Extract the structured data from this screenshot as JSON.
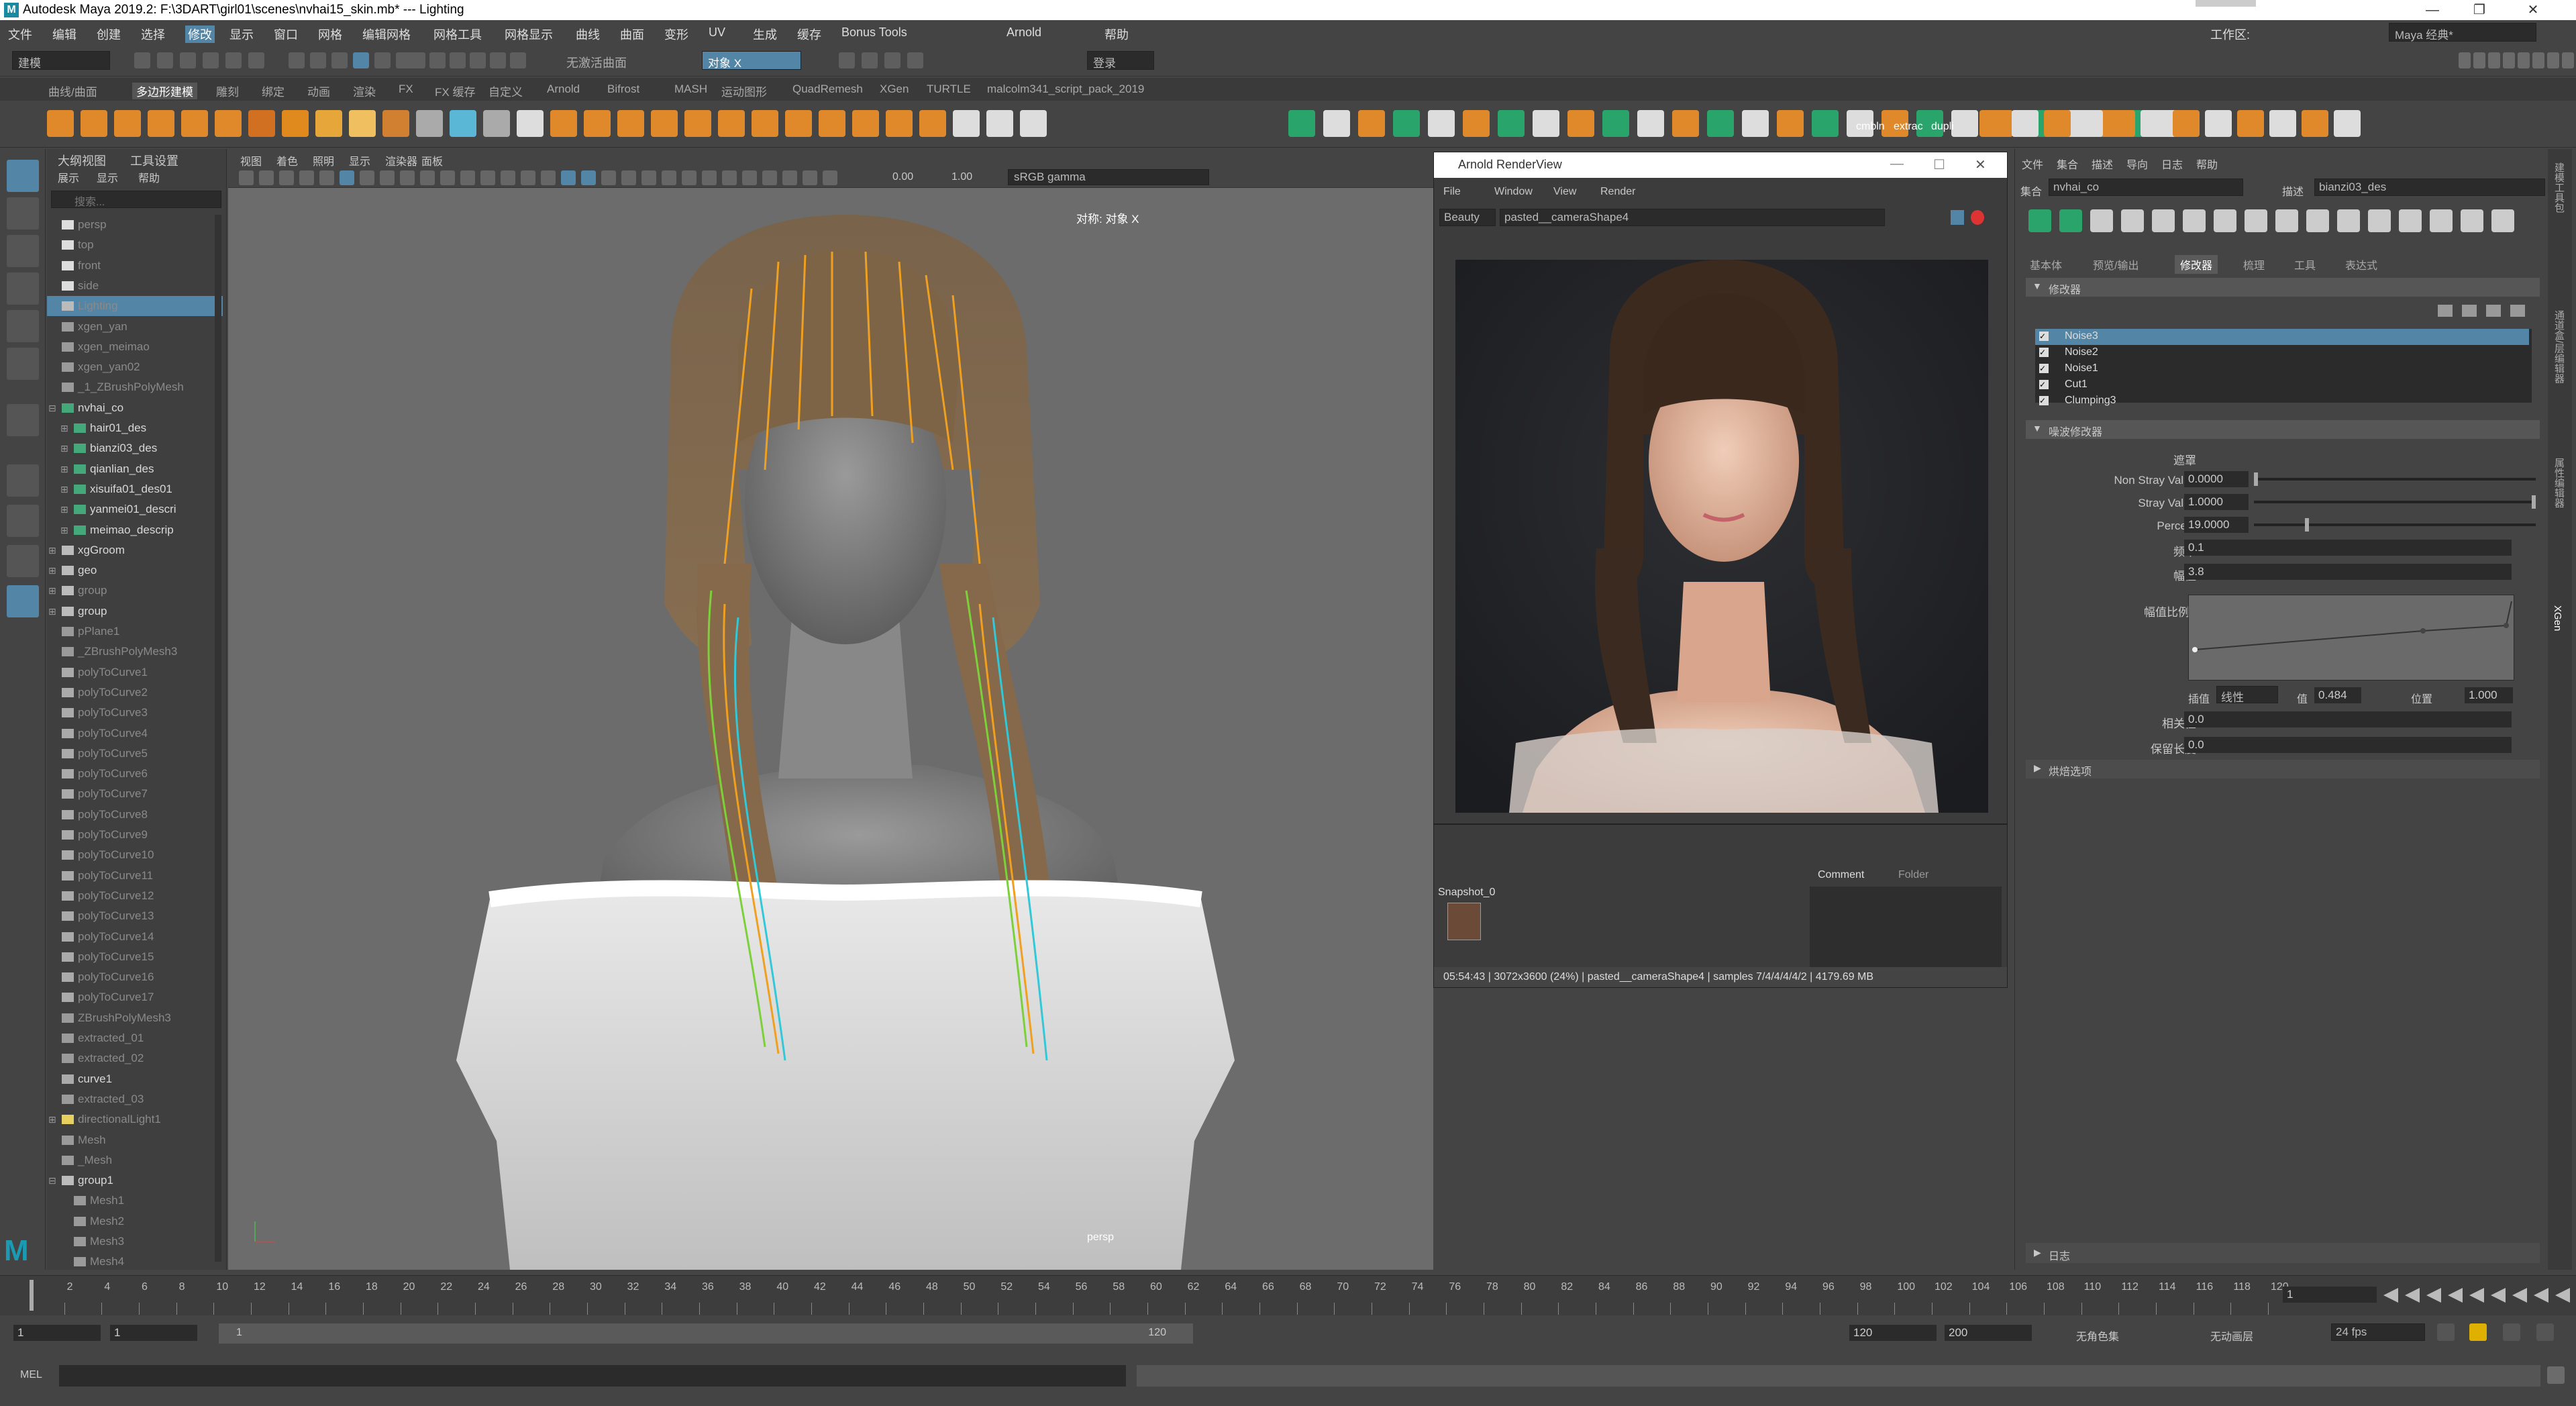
{
  "window": {
    "title": "Autodesk Maya 2019.2: F:\\3DART\\girl01\\scenes\\nvhai15_skin.mb*  ---  Lighting",
    "logo": "M"
  },
  "menubar": {
    "items": [
      "文件",
      "编辑",
      "创建",
      "选择",
      "修改",
      "显示",
      "窗口",
      "网格",
      "编辑网格",
      "网格工具",
      "网格显示",
      "曲线",
      "曲面",
      "变形",
      "UV",
      "生成",
      "缓存",
      "Bonus Tools",
      "Arnold",
      "帮助"
    ],
    "workspace_label": "工作区:",
    "workspace_value": "Maya 经典*"
  },
  "statusline": {
    "mode": "建模",
    "no_live_surface": "无激活曲面",
    "symmetry": "对象 X",
    "user": "登录"
  },
  "shelf": {
    "tabs": [
      "曲线/曲面",
      "多边形建模",
      "雕刻",
      "绑定",
      "动画",
      "渲染",
      "FX",
      "FX 缓存",
      "自定义",
      "Arnold",
      "Bifrost",
      "MASH",
      "运动图形",
      "QuadRemesh",
      "XGen",
      "TURTLE",
      "malcolm341_script_pack_2019"
    ],
    "active_tab": "多边形建模",
    "text_buttons": [
      "cmbln",
      "extrac",
      "dupli"
    ]
  },
  "outliner": {
    "menus": [
      "大纲视图",
      "工具设置"
    ],
    "submenus": [
      "展示",
      "显示",
      "帮助"
    ],
    "search_placeholder": "搜索...",
    "rows": [
      {
        "label": "persp",
        "icon": "camera",
        "indent": 0,
        "dim": true
      },
      {
        "label": "top",
        "icon": "camera",
        "indent": 0,
        "dim": true
      },
      {
        "label": "front",
        "icon": "camera",
        "indent": 0,
        "dim": true
      },
      {
        "label": "side",
        "icon": "camera",
        "indent": 0,
        "dim": true
      },
      {
        "label": "Lighting",
        "icon": "group",
        "indent": 0,
        "dim": true,
        "selected": true
      },
      {
        "label": "xgen_yan",
        "icon": "mesh",
        "indent": 0,
        "dim": true
      },
      {
        "label": "xgen_meimao",
        "icon": "mesh",
        "indent": 0,
        "dim": true
      },
      {
        "label": "xgen_yan02",
        "icon": "mesh",
        "indent": 0,
        "dim": true
      },
      {
        "label": "_1_ZBrushPolyMesh",
        "icon": "mesh",
        "indent": 0,
        "dim": true
      },
      {
        "label": "nvhai_co",
        "icon": "xgen",
        "indent": 0,
        "expand": "minus"
      },
      {
        "label": "hair01_des",
        "icon": "xgen",
        "indent": 1,
        "expand": "plus"
      },
      {
        "label": "bianzi03_des",
        "icon": "xgen",
        "indent": 1,
        "expand": "plus"
      },
      {
        "label": "qianlian_des",
        "icon": "xgen",
        "indent": 1,
        "expand": "plus"
      },
      {
        "label": "xisuifa01_des01",
        "icon": "xgen",
        "indent": 1,
        "expand": "plus"
      },
      {
        "label": "yanmei01_descri",
        "icon": "xgen",
        "indent": 1,
        "expand": "plus"
      },
      {
        "label": "meimao_descrip",
        "icon": "xgen",
        "indent": 1,
        "expand": "plus"
      },
      {
        "label": "xgGroom",
        "icon": "group",
        "indent": 0,
        "expand": "plus"
      },
      {
        "label": "geo",
        "icon": "group",
        "indent": 0,
        "expand": "plus"
      },
      {
        "label": "group",
        "icon": "group",
        "indent": 0,
        "expand": "plus",
        "dim": true
      },
      {
        "label": "group",
        "icon": "group",
        "indent": 0,
        "expand": "plus"
      },
      {
        "label": "pPlane1",
        "icon": "mesh",
        "indent": 0,
        "dim": true
      },
      {
        "label": "_ZBrushPolyMesh3",
        "icon": "mesh",
        "indent": 0,
        "dim": true
      },
      {
        "label": "polyToCurve1",
        "icon": "curve",
        "indent": 0,
        "dim": true
      },
      {
        "label": "polyToCurve2",
        "icon": "curve",
        "indent": 0,
        "dim": true
      },
      {
        "label": "polyToCurve3",
        "icon": "curve",
        "indent": 0,
        "dim": true
      },
      {
        "label": "polyToCurve4",
        "icon": "curve",
        "indent": 0,
        "dim": true
      },
      {
        "label": "polyToCurve5",
        "icon": "curve",
        "indent": 0,
        "dim": true
      },
      {
        "label": "polyToCurve6",
        "icon": "curve",
        "indent": 0,
        "dim": true
      },
      {
        "label": "polyToCurve7",
        "icon": "curve",
        "indent": 0,
        "dim": true
      },
      {
        "label": "polyToCurve8",
        "icon": "curve",
        "indent": 0,
        "dim": true
      },
      {
        "label": "polyToCurve9",
        "icon": "curve",
        "indent": 0,
        "dim": true
      },
      {
        "label": "polyToCurve10",
        "icon": "curve",
        "indent": 0,
        "dim": true
      },
      {
        "label": "polyToCurve11",
        "icon": "curve",
        "indent": 0,
        "dim": true
      },
      {
        "label": "polyToCurve12",
        "icon": "curve",
        "indent": 0,
        "dim": true
      },
      {
        "label": "polyToCurve13",
        "icon": "curve",
        "indent": 0,
        "dim": true
      },
      {
        "label": "polyToCurve14",
        "icon": "curve",
        "indent": 0,
        "dim": true
      },
      {
        "label": "polyToCurve15",
        "icon": "curve",
        "indent": 0,
        "dim": true
      },
      {
        "label": "polyToCurve16",
        "icon": "curve",
        "indent": 0,
        "dim": true
      },
      {
        "label": "polyToCurve17",
        "icon": "curve",
        "indent": 0,
        "dim": true
      },
      {
        "label": "ZBrushPolyMesh3",
        "icon": "mesh",
        "indent": 0,
        "dim": true
      },
      {
        "label": "extracted_01",
        "icon": "mesh",
        "indent": 0,
        "dim": true
      },
      {
        "label": "extracted_02",
        "icon": "mesh",
        "indent": 0,
        "dim": true
      },
      {
        "label": "curve1",
        "icon": "curve",
        "indent": 0
      },
      {
        "label": "extracted_03",
        "icon": "mesh",
        "indent": 0,
        "dim": true
      },
      {
        "label": "directionalLight1",
        "icon": "light",
        "indent": 0,
        "expand": "plus",
        "dim": true
      },
      {
        "label": "Mesh",
        "icon": "mesh",
        "indent": 0,
        "dim": true
      },
      {
        "label": "_Mesh",
        "icon": "mesh",
        "indent": 0,
        "dim": true
      },
      {
        "label": "group1",
        "icon": "group",
        "indent": 0,
        "expand": "minus"
      },
      {
        "label": "Mesh1",
        "icon": "mesh",
        "indent": 1,
        "dim": true
      },
      {
        "label": "Mesh2",
        "icon": "mesh",
        "indent": 1,
        "dim": true
      },
      {
        "label": "Mesh3",
        "icon": "mesh",
        "indent": 1,
        "dim": true
      },
      {
        "label": "Mesh4",
        "icon": "mesh",
        "indent": 1,
        "dim": true
      }
    ]
  },
  "viewport": {
    "menus": [
      "视图",
      "着色",
      "照明",
      "显示",
      "渲染器",
      "面板"
    ],
    "exposure": "0.00",
    "gamma": "1.00",
    "colorspace": "sRGB gamma",
    "symmetry_label": "对称: 对象 X",
    "camera_label": "persp"
  },
  "renderview": {
    "title": "Arnold RenderView",
    "menus": [
      "File",
      "Window",
      "View",
      "Render"
    ],
    "aov": "Beauty",
    "camera": "pasted__cameraShape4",
    "snapshot_label": "Snapshot_0",
    "tabs": [
      "Comment",
      "Folder"
    ],
    "status": "05:54:43 | 3072x3600 (24%) | pasted__cameraShape4  | samples 7/4/4/4/4/2 | 4179.69 MB"
  },
  "attr": {
    "menus": [
      "文件",
      "集合",
      "描述",
      "导向",
      "日志",
      "帮助"
    ],
    "collection_label": "集合",
    "collection_value": "nvhai_co",
    "desc_label": "描述",
    "desc_value": "bianzi03_des",
    "tabs": [
      "基本体",
      "预览/输出",
      "修改器",
      "梳理",
      "工具",
      "表达式"
    ],
    "active_tab": "修改器",
    "modifiers_header": "修改器",
    "modifiers": [
      "Noise3",
      "Noise2",
      "Noise1",
      "Cut1",
      "Clumping3"
    ],
    "filter_header": "噪波修改器",
    "mask_label": "遮罩",
    "non_stray_label": "Non Stray Value",
    "non_stray_value": "0.0000",
    "stray_label": "Stray Value",
    "stray_value": "1.0000",
    "percent_label": "Percent",
    "percent_value": "19.0000",
    "freq_label": "频率",
    "freq_value": "0.1",
    "amp_label": "幅值",
    "amp_value": "3.8",
    "amp_scale_label": "幅值比例",
    "interp_label": "插值",
    "interp_value": "线性",
    "value_label": "值",
    "value_value": "0.484",
    "pos_label": "位置",
    "pos_value": "1.000",
    "corr_label": "相关性",
    "corr_value": "0.0",
    "keep_len_label": "保留长度",
    "keep_len_value": "0.0",
    "bake_label": "烘焙选项",
    "log_label": "日志",
    "side_tabs": [
      "建模工具包",
      "通道盒/层编辑器",
      "属性编辑器",
      "XGen"
    ]
  },
  "timeline": {
    "ticks": [
      "2",
      "4",
      "6",
      "8",
      "10",
      "12",
      "14",
      "16",
      "18",
      "20",
      "22",
      "24",
      "26",
      "28",
      "30",
      "32",
      "34",
      "36",
      "38",
      "40",
      "42",
      "44",
      "46",
      "48",
      "50",
      "52",
      "54",
      "56",
      "58",
      "60",
      "62",
      "64",
      "66",
      "68",
      "70",
      "72",
      "74",
      "76",
      "78",
      "80",
      "82",
      "84",
      "86",
      "88",
      "90",
      "92",
      "94",
      "96",
      "98",
      "100",
      "102",
      "104",
      "106",
      "108",
      "110",
      "112",
      "114",
      "116",
      "118",
      "120"
    ],
    "current_frame": "1"
  },
  "range": {
    "start": "1",
    "start2": "1",
    "slider_start": "1",
    "slider_end": "120",
    "end": "120",
    "end2": "200",
    "char_set": "无角色集",
    "anim_layer": "无动画层",
    "fps": "24 fps"
  },
  "cmdline": {
    "label": "MEL"
  },
  "colors": {
    "selection": "#5285a6",
    "guide_orange": "#f0a020",
    "guide_green": "#7cd13a",
    "guide_cyan": "#32c8d8",
    "accent": "#1a8aa0"
  }
}
